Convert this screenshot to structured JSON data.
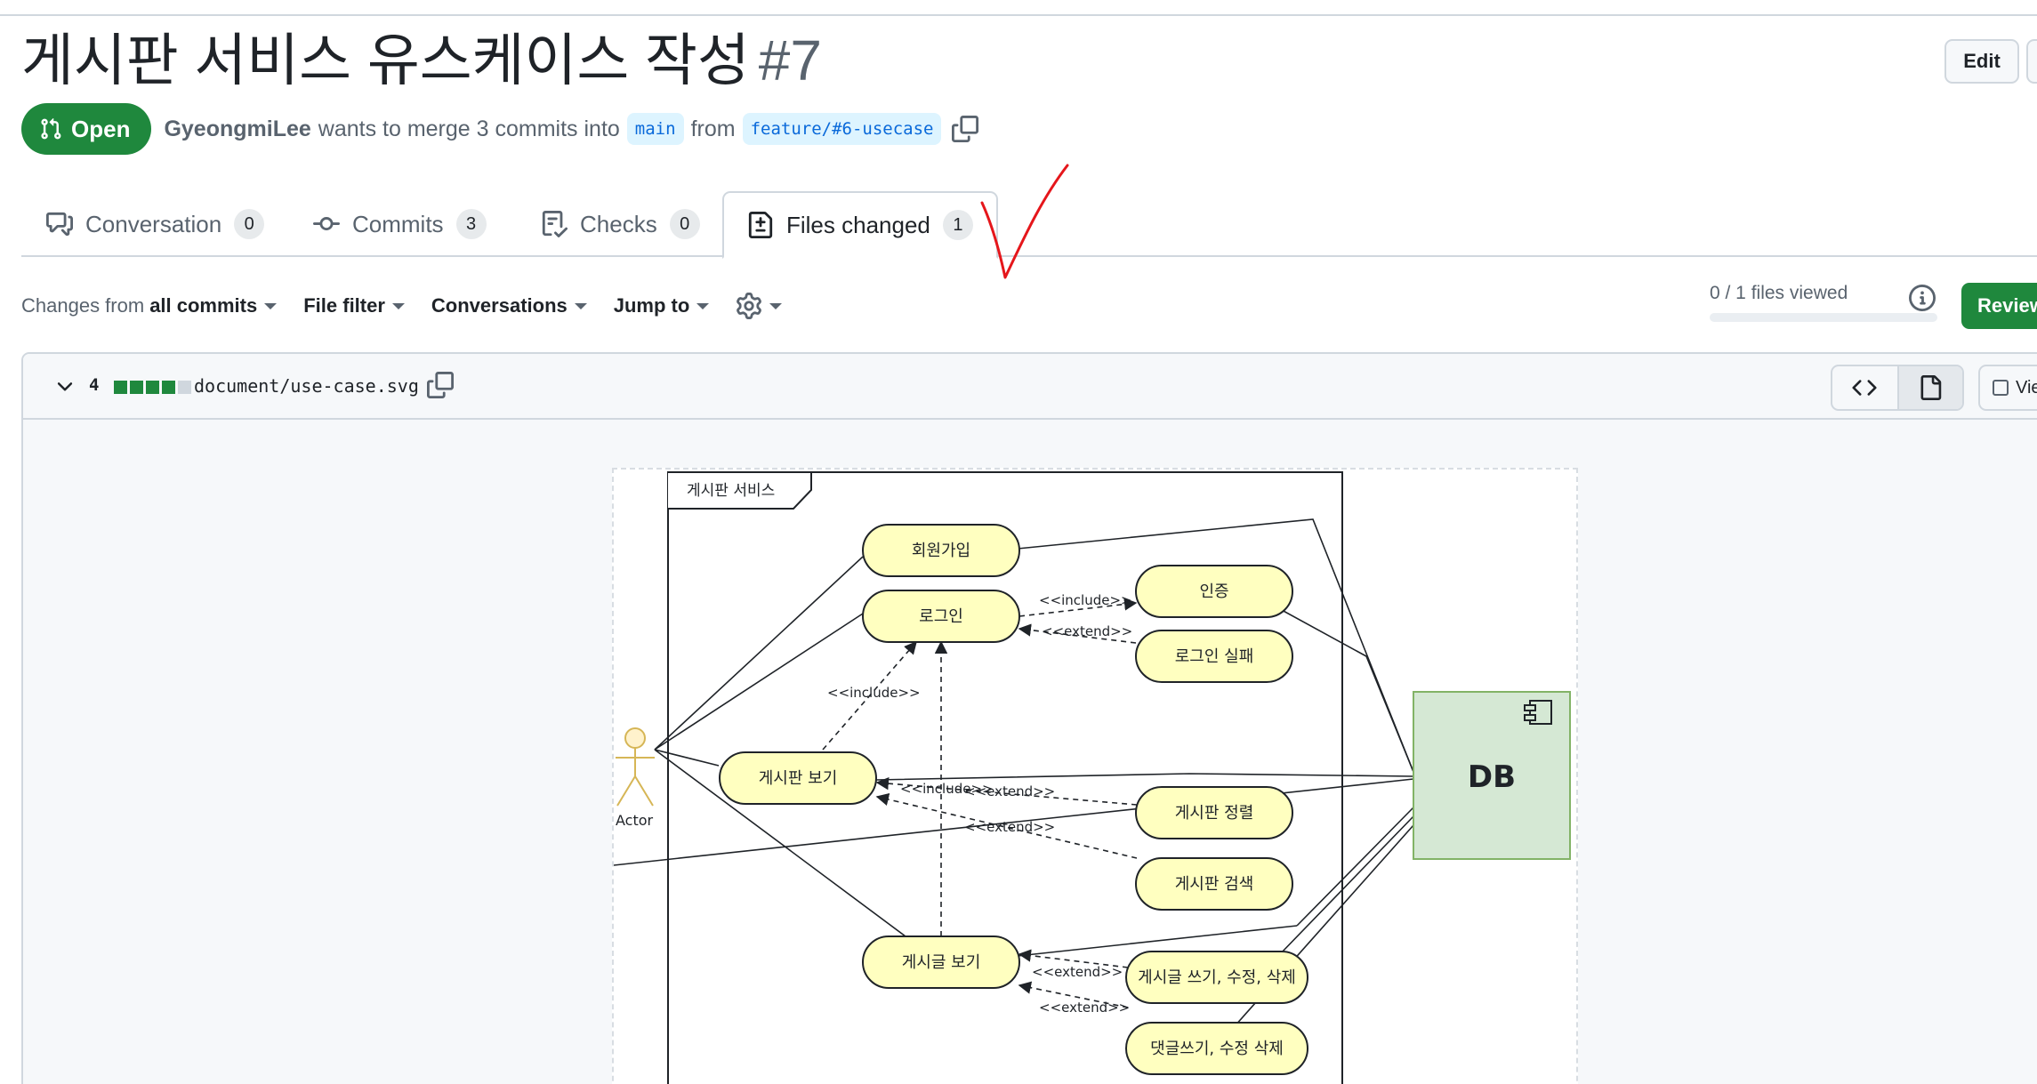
{
  "pr": {
    "title": "게시판 서비스 유스케이스 작성",
    "number": "#7",
    "edit_label": "Edit",
    "state": "Open",
    "author": "GyeongmiLee",
    "merge_text": "wants to merge 3 commits into",
    "base_branch": "main",
    "from_text": "from",
    "head_branch": "feature/#6-usecase"
  },
  "tabs": [
    {
      "label": "Conversation",
      "count": "0",
      "icon": "comment-discussion-icon"
    },
    {
      "label": "Commits",
      "count": "3",
      "icon": "git-commit-icon"
    },
    {
      "label": "Checks",
      "count": "0",
      "icon": "checklist-icon"
    },
    {
      "label": "Files changed",
      "count": "1",
      "icon": "file-diff-icon",
      "selected": true
    }
  ],
  "toolbar": {
    "changes_prefix": "Changes from",
    "changes_value": "all commits",
    "file_filter": "File filter",
    "conversations": "Conversations",
    "jump_to": "Jump to",
    "files_viewed": "0 / 1 files viewed",
    "files_viewed_fraction": 0,
    "review_label": "Review changes"
  },
  "file": {
    "changes": "4",
    "path": "document/use-case.svg",
    "viewed_label": "Viewed",
    "diffstat": [
      "added",
      "added",
      "added",
      "added",
      "neutral"
    ]
  },
  "diagram": {
    "frame_label": "게시판 서비스",
    "actor_label": "Actor",
    "db_label": "DB",
    "use_cases": {
      "signup": "회원가입",
      "login": "로그인",
      "auth": "인증",
      "login_fail": "로그인 실패",
      "board_view": "게시판 보기",
      "board_sort": "게시판 정렬",
      "board_search": "게시판 검색",
      "post_view": "게시글 보기",
      "post_write": "게시글 쓰기, 수정, 삭제",
      "comment_write": "댓글쓰기, 수정 삭제"
    },
    "relations": {
      "include": "<<include>>",
      "extend": "<<extend>>"
    }
  },
  "colors": {
    "accent_green": "#1f883d",
    "link_blue": "#0969da",
    "usecase_fill": "#ffffc0",
    "db_fill": "#d5e8d4",
    "db_border": "#82b366",
    "annotation_red": "#e5161b"
  }
}
